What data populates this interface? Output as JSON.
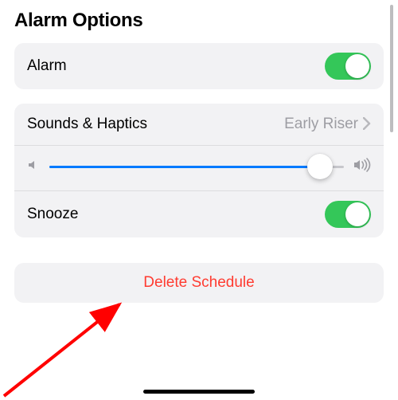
{
  "section_title": "Alarm Options",
  "alarm": {
    "label": "Alarm",
    "on": true
  },
  "sounds": {
    "label": "Sounds & Haptics",
    "value": "Early Riser",
    "volume_percent": 92
  },
  "snooze": {
    "label": "Snooze",
    "on": true
  },
  "delete": {
    "label": "Delete Schedule"
  },
  "colors": {
    "toggle_on": "#34c759",
    "slider_fill": "#007aff",
    "destructive": "#ff3b30"
  }
}
